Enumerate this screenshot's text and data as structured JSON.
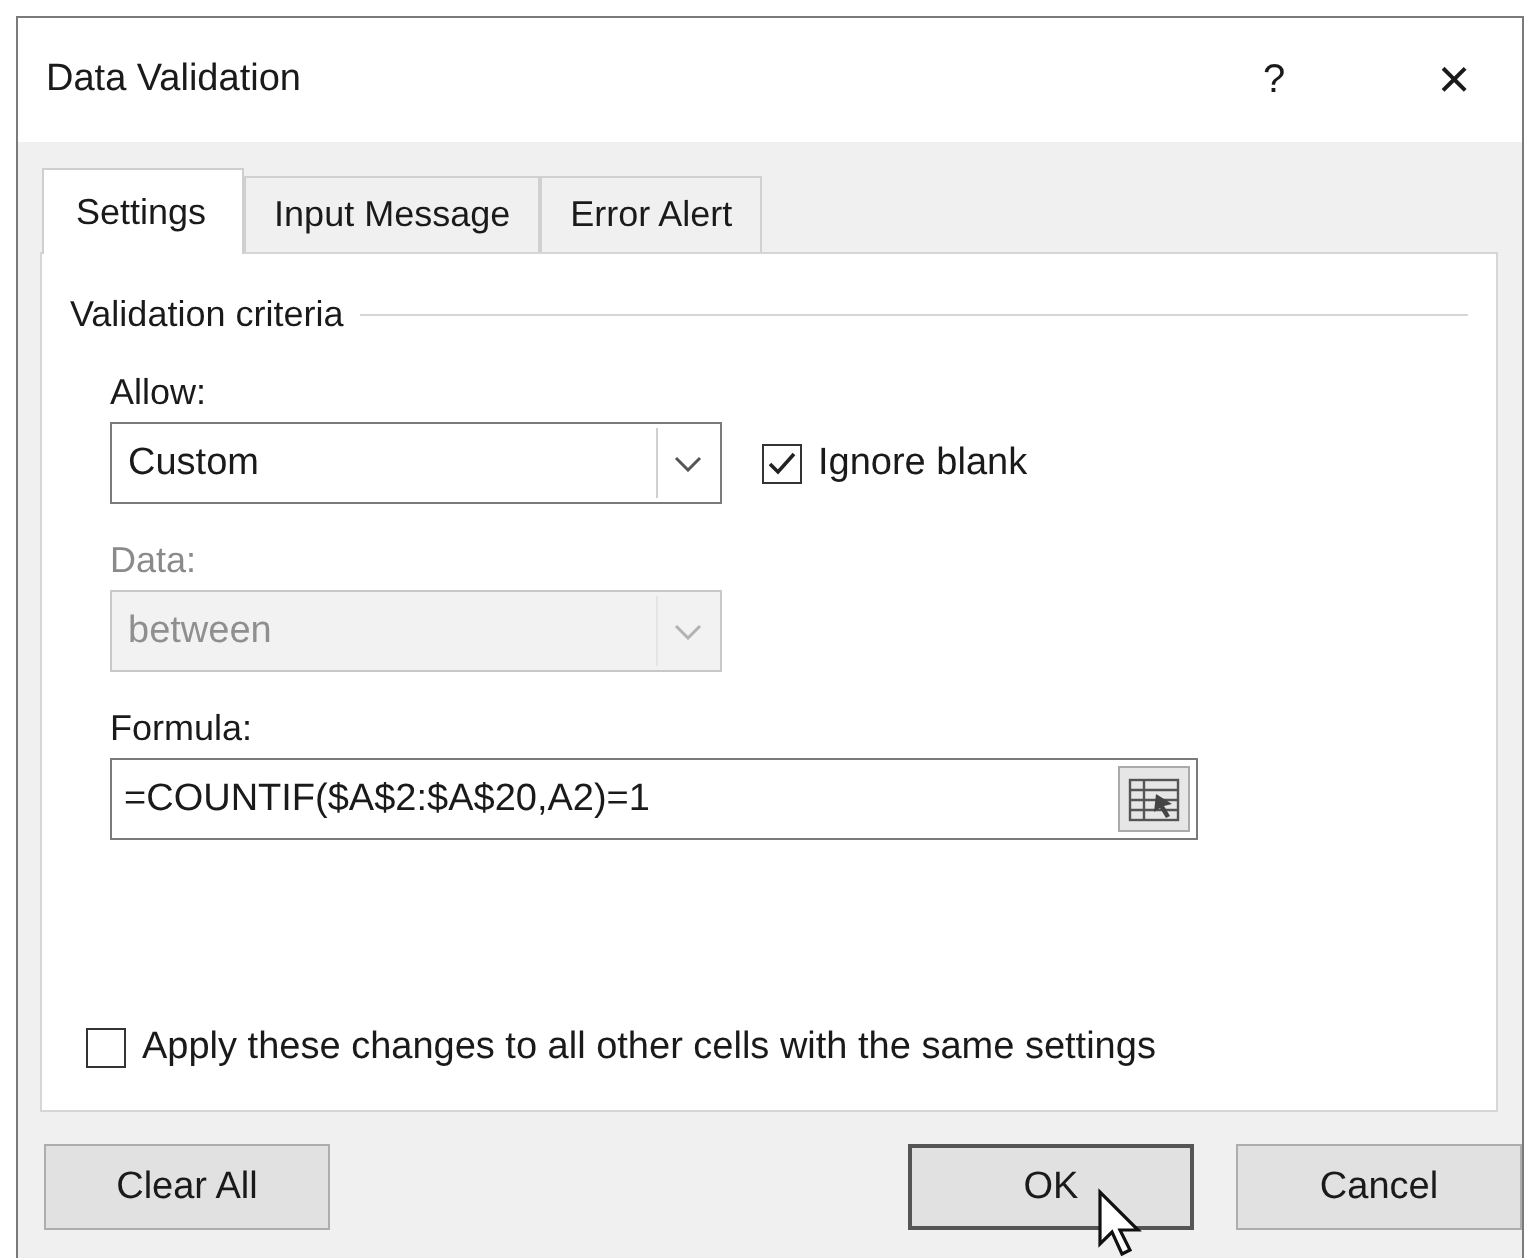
{
  "window": {
    "title": "Data Validation",
    "help": "?",
    "close": "×"
  },
  "tabs": [
    {
      "label": "Settings",
      "selected": true
    },
    {
      "label": "Input Message",
      "selected": false
    },
    {
      "label": "Error Alert",
      "selected": false
    }
  ],
  "section_title": "Validation criteria",
  "allow": {
    "label": "Allow:",
    "value": "Custom",
    "disabled": false
  },
  "ignore_blank": {
    "label": "Ignore blank",
    "checked": true
  },
  "data": {
    "label": "Data:",
    "value": "between",
    "disabled": true
  },
  "formula": {
    "label": "Formula:",
    "value": "=COUNTIF($A$2:$A$20,A2)=1"
  },
  "apply_all": {
    "label": "Apply these changes to all other cells with the same settings",
    "checked": false
  },
  "buttons": [
    {
      "label": "Clear All",
      "kind": "left"
    },
    {
      "label": "OK",
      "kind": "default"
    },
    {
      "label": "Cancel",
      "kind": "right"
    }
  ]
}
